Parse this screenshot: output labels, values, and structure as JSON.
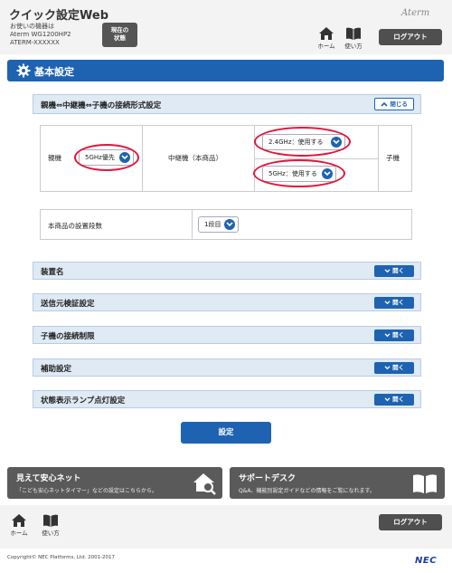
{
  "header": {
    "app_title": "クイック設定Web",
    "device_label": "お使いの機器は",
    "device_model": "Aterm WG1200HP2",
    "device_id": "ATERM-XXXXXX",
    "status_button": [
      "現在の",
      "状態"
    ],
    "brand": "Aterm",
    "home_label": "ホーム",
    "manual_label": "使い方",
    "logout_label": "ログアウト"
  },
  "section": {
    "title": "基本設定"
  },
  "connection_panel": {
    "title": "親機⇔中継機⇔子機の接続形式設定",
    "close_label": "閉じる",
    "parent_label": "親機",
    "parent_value": "5GHz優先",
    "repeater_label": "中継機（本商品）",
    "band24_value": "2.4GHz：使用する",
    "band5_value": "5GHz：使用する",
    "child_label": "子機",
    "stage_label": "本商品の設置段数",
    "stage_value": "1段目"
  },
  "accordions": [
    {
      "title": "装置名",
      "button": "開く"
    },
    {
      "title": "送信元検証設定",
      "button": "開く"
    },
    {
      "title": "子機の接続制限",
      "button": "開く"
    },
    {
      "title": "補助設定",
      "button": "開く"
    },
    {
      "title": "状態表示ランプ点灯設定",
      "button": "開く"
    }
  ],
  "submit_label": "設定",
  "banners": {
    "safety_title": "見えて安心ネット",
    "safety_sub": "「こども安心ネットタイマー」などの設定はこちらから。",
    "support_title": "サポートデスク",
    "support_sub": "Q&A、機能別設定ガイドなどの情報をご覧になれます。"
  },
  "footer": {
    "home_label": "ホーム",
    "manual_label": "使い方",
    "logout_label": "ログアウト",
    "copyright": "Copyright© NEC Platforms, Ltd. 2001-2017",
    "company_logo": "NEC"
  },
  "colors": {
    "accent": "#1e63b2",
    "highlight_ring": "#e5133b",
    "panel_bg": "#dfeaf5",
    "dark_button": "#4f4f4f"
  },
  "icons": [
    "home-icon",
    "book-icon",
    "gear-icon",
    "chevron-down-icon",
    "chevron-up-icon",
    "house-search-icon"
  ]
}
